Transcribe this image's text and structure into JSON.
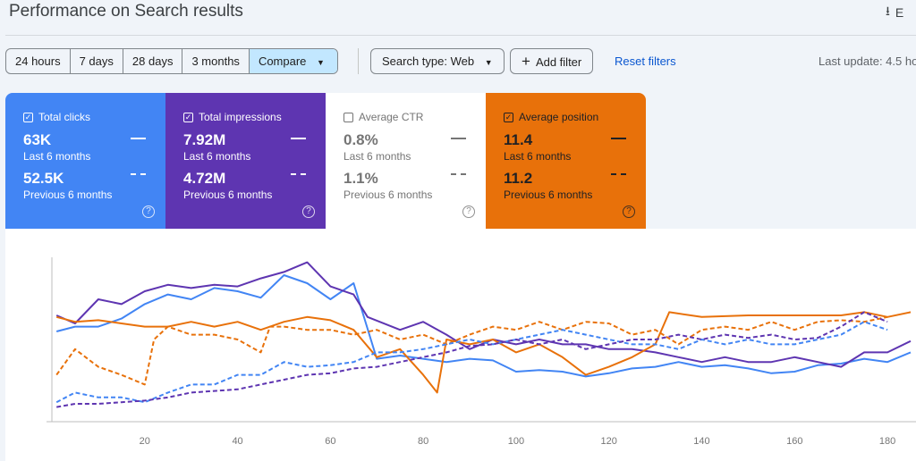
{
  "header": {
    "title": "Performance on Search results",
    "export_label": "E",
    "export_icon": "download-icon"
  },
  "toolbar": {
    "ranges": [
      "24 hours",
      "7 days",
      "28 days",
      "3 months",
      "Compare"
    ],
    "search_type": "Search type: Web",
    "add_filter": "Add filter",
    "reset": "Reset filters",
    "last_update": "Last update: 4.5 ho"
  },
  "cards": [
    {
      "label": "Total clicks",
      "checked": true,
      "current": "63K",
      "current_label": "Last 6 months",
      "previous": "52.5K",
      "previous_label": "Previous 6 months",
      "bg": "#4285f4",
      "fg": "#ffffff"
    },
    {
      "label": "Total impressions",
      "checked": true,
      "current": "7.92M",
      "current_label": "Last 6 months",
      "previous": "4.72M",
      "previous_label": "Previous 6 months",
      "bg": "#5e35b1",
      "fg": "#ffffff"
    },
    {
      "label": "Average CTR",
      "checked": false,
      "current": "0.8%",
      "current_label": "Last 6 months",
      "previous": "1.1%",
      "previous_label": "Previous 6 months",
      "bg": "#ffffff",
      "fg": "#757575"
    },
    {
      "label": "Average position",
      "checked": true,
      "current": "11.4",
      "current_label": "Last 6 months",
      "previous": "11.2",
      "previous_label": "Previous 6 months",
      "bg": "#e8710a",
      "fg": "#202124"
    }
  ],
  "chart_data": {
    "type": "line",
    "x_ticks": [
      20,
      40,
      60,
      80,
      100,
      120,
      140,
      160,
      180
    ],
    "xlim": [
      0,
      185
    ],
    "y_axis_labels": "none",
    "grid": false,
    "series": [
      {
        "metric": "clicks",
        "period": "current",
        "color": "#4285f4",
        "style": "solid",
        "x": [
          1,
          5,
          10,
          15,
          20,
          25,
          30,
          35,
          40,
          45,
          50,
          55,
          60,
          65,
          70,
          75,
          80,
          85,
          90,
          95,
          100,
          105,
          110,
          115,
          120,
          125,
          130,
          135,
          140,
          145,
          150,
          155,
          160,
          165,
          170,
          175,
          180,
          185
        ],
        "y": [
          55,
          58,
          58,
          63,
          72,
          78,
          75,
          82,
          80,
          76,
          90,
          85,
          75,
          85,
          38,
          40,
          38,
          36,
          38,
          37,
          30,
          31,
          30,
          27,
          29,
          32,
          33,
          36,
          33,
          34,
          32,
          29,
          30,
          34,
          35,
          38,
          36,
          42
        ]
      },
      {
        "metric": "impressions",
        "period": "current",
        "color": "#5e35b1",
        "style": "solid",
        "x": [
          1,
          5,
          10,
          15,
          20,
          25,
          30,
          35,
          40,
          45,
          50,
          55,
          60,
          65,
          68,
          75,
          80,
          85,
          90,
          95,
          100,
          105,
          110,
          115,
          120,
          125,
          130,
          135,
          140,
          145,
          150,
          155,
          160,
          165,
          170,
          175,
          180,
          185
        ],
        "y": [
          65,
          60,
          75,
          72,
          80,
          84,
          82,
          84,
          83,
          88,
          92,
          98,
          83,
          78,
          64,
          56,
          61,
          53,
          44,
          50,
          47,
          50,
          47,
          47,
          44,
          44,
          42,
          39,
          36,
          39,
          36,
          36,
          39,
          36,
          33,
          42,
          42,
          49
        ]
      },
      {
        "metric": "position",
        "period": "current",
        "color": "#e8710a",
        "style": "solid",
        "x": [
          1,
          5,
          10,
          15,
          20,
          25,
          30,
          35,
          40,
          45,
          50,
          55,
          60,
          65,
          70,
          75,
          80,
          83,
          85,
          90,
          95,
          100,
          105,
          110,
          115,
          120,
          125,
          130,
          133,
          140,
          150,
          160,
          170,
          175,
          180,
          185
        ],
        "y": [
          64,
          61,
          62,
          60,
          58,
          58,
          61,
          58,
          61,
          56,
          61,
          64,
          62,
          56,
          39,
          44,
          28,
          17,
          50,
          47,
          50,
          42,
          47,
          39,
          28,
          33,
          39,
          47,
          67,
          64,
          65,
          65,
          65,
          67,
          64,
          67
        ]
      },
      {
        "metric": "position",
        "period": "previous",
        "color": "#e8710a",
        "style": "dashed",
        "x": [
          1,
          5,
          10,
          15,
          20,
          22,
          25,
          30,
          35,
          40,
          45,
          47,
          50,
          55,
          60,
          65,
          70,
          75,
          80,
          85,
          90,
          95,
          100,
          105,
          110,
          115,
          120,
          125,
          130,
          135,
          140,
          145,
          150,
          155,
          160,
          165,
          170,
          175,
          180
        ],
        "y": [
          28,
          44,
          33,
          28,
          22,
          50,
          58,
          53,
          53,
          50,
          42,
          58,
          58,
          56,
          56,
          53,
          56,
          50,
          53,
          47,
          53,
          58,
          56,
          61,
          56,
          61,
          60,
          53,
          56,
          47,
          56,
          58,
          56,
          61,
          56,
          61,
          62,
          61,
          64
        ]
      },
      {
        "metric": "clicks",
        "period": "previous",
        "color": "#4285f4",
        "style": "dashed",
        "x": [
          1,
          5,
          10,
          15,
          20,
          25,
          30,
          35,
          40,
          45,
          50,
          55,
          60,
          65,
          70,
          75,
          80,
          85,
          90,
          95,
          100,
          105,
          110,
          115,
          120,
          125,
          130,
          135,
          140,
          145,
          150,
          155,
          160,
          165,
          170,
          175,
          180
        ],
        "y": [
          11,
          17,
          14,
          14,
          11,
          17,
          22,
          22,
          28,
          28,
          36,
          33,
          34,
          36,
          42,
          42,
          44,
          47,
          50,
          47,
          50,
          53,
          56,
          53,
          50,
          47,
          47,
          44,
          50,
          47,
          50,
          47,
          47,
          50,
          53,
          61,
          56
        ]
      },
      {
        "metric": "impressions",
        "period": "previous",
        "color": "#5e35b1",
        "style": "dashed",
        "x": [
          1,
          5,
          10,
          15,
          20,
          25,
          30,
          35,
          40,
          45,
          50,
          55,
          60,
          65,
          70,
          75,
          80,
          85,
          90,
          95,
          100,
          105,
          110,
          115,
          120,
          125,
          130,
          135,
          140,
          145,
          150,
          155,
          160,
          165,
          170,
          175,
          180
        ],
        "y": [
          8,
          10,
          10,
          11,
          12,
          14,
          17,
          18,
          19,
          22,
          25,
          28,
          29,
          32,
          33,
          36,
          39,
          42,
          46,
          47,
          50,
          47,
          50,
          44,
          47,
          50,
          50,
          53,
          50,
          53,
          51,
          53,
          50,
          51,
          58,
          67,
          61
        ]
      }
    ]
  }
}
